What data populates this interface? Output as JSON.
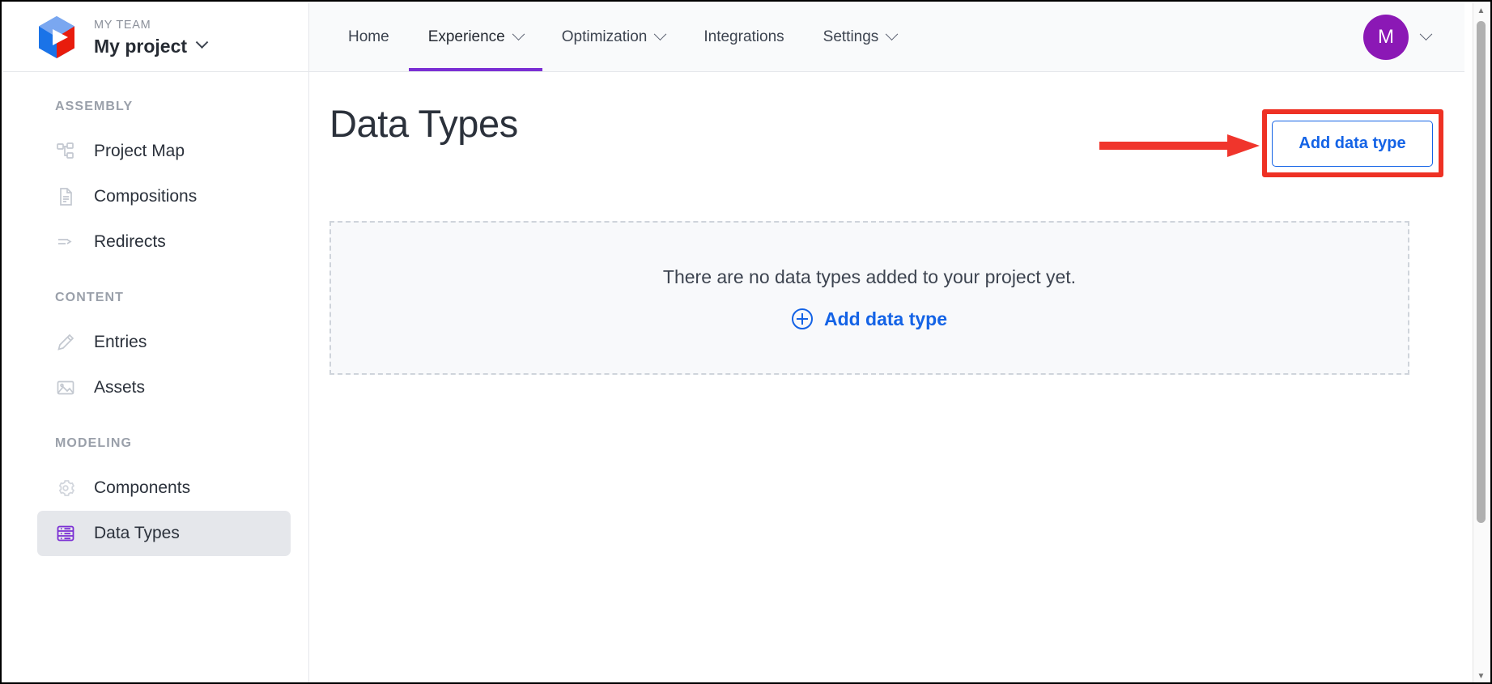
{
  "header": {
    "team_label": "MY TEAM",
    "project_name": "My project",
    "logo_icon": "hexagon-play-logo",
    "project_chevron_icon": "chevron-down-icon",
    "nav": [
      {
        "label": "Home",
        "has_caret": false,
        "active": false,
        "icon": ""
      },
      {
        "label": "Experience",
        "has_caret": true,
        "active": true,
        "icon": "chevron-down-icon"
      },
      {
        "label": "Optimization",
        "has_caret": true,
        "active": false,
        "icon": "chevron-down-icon"
      },
      {
        "label": "Integrations",
        "has_caret": false,
        "active": false,
        "icon": ""
      },
      {
        "label": "Settings",
        "has_caret": true,
        "active": false,
        "icon": "chevron-down-icon"
      }
    ],
    "avatar_initial": "M",
    "avatar_chevron_icon": "chevron-down-icon",
    "active_tab_color": "#7b2fd4",
    "avatar_color": "#8b18b5"
  },
  "sidebar": {
    "groups": [
      {
        "label": "ASSEMBLY",
        "items": [
          {
            "label": "Project Map",
            "icon": "sitemap-icon",
            "selected": false
          },
          {
            "label": "Compositions",
            "icon": "document-icon",
            "selected": false
          },
          {
            "label": "Redirects",
            "icon": "arrow-lines-icon",
            "selected": false
          }
        ]
      },
      {
        "label": "CONTENT",
        "items": [
          {
            "label": "Entries",
            "icon": "pencil-icon",
            "selected": false
          },
          {
            "label": "Assets",
            "icon": "image-icon",
            "selected": false
          }
        ]
      },
      {
        "label": "MODELING",
        "items": [
          {
            "label": "Components",
            "icon": "gear-icon",
            "selected": false
          },
          {
            "label": "Data Types",
            "icon": "data-table-icon",
            "selected": true
          }
        ]
      }
    ],
    "selected_icon_color": "#7b2fd4",
    "selected_bg_color": "#e5e7eb"
  },
  "main": {
    "page_title": "Data Types",
    "add_button_label": "Add data type",
    "empty_state": {
      "message": "There are no data types added to your project yet.",
      "link_label": "Add data type",
      "link_icon": "plus-circle-icon"
    },
    "accent_color": "#1463e6"
  },
  "annotations": {
    "highlight_box": "red-highlight-box",
    "arrow": "red-arrow-pointing-right",
    "color": "#ee3124"
  },
  "scrollbar": {
    "up_icon": "scroll-up-arrow",
    "down_icon": "scroll-down-arrow"
  }
}
